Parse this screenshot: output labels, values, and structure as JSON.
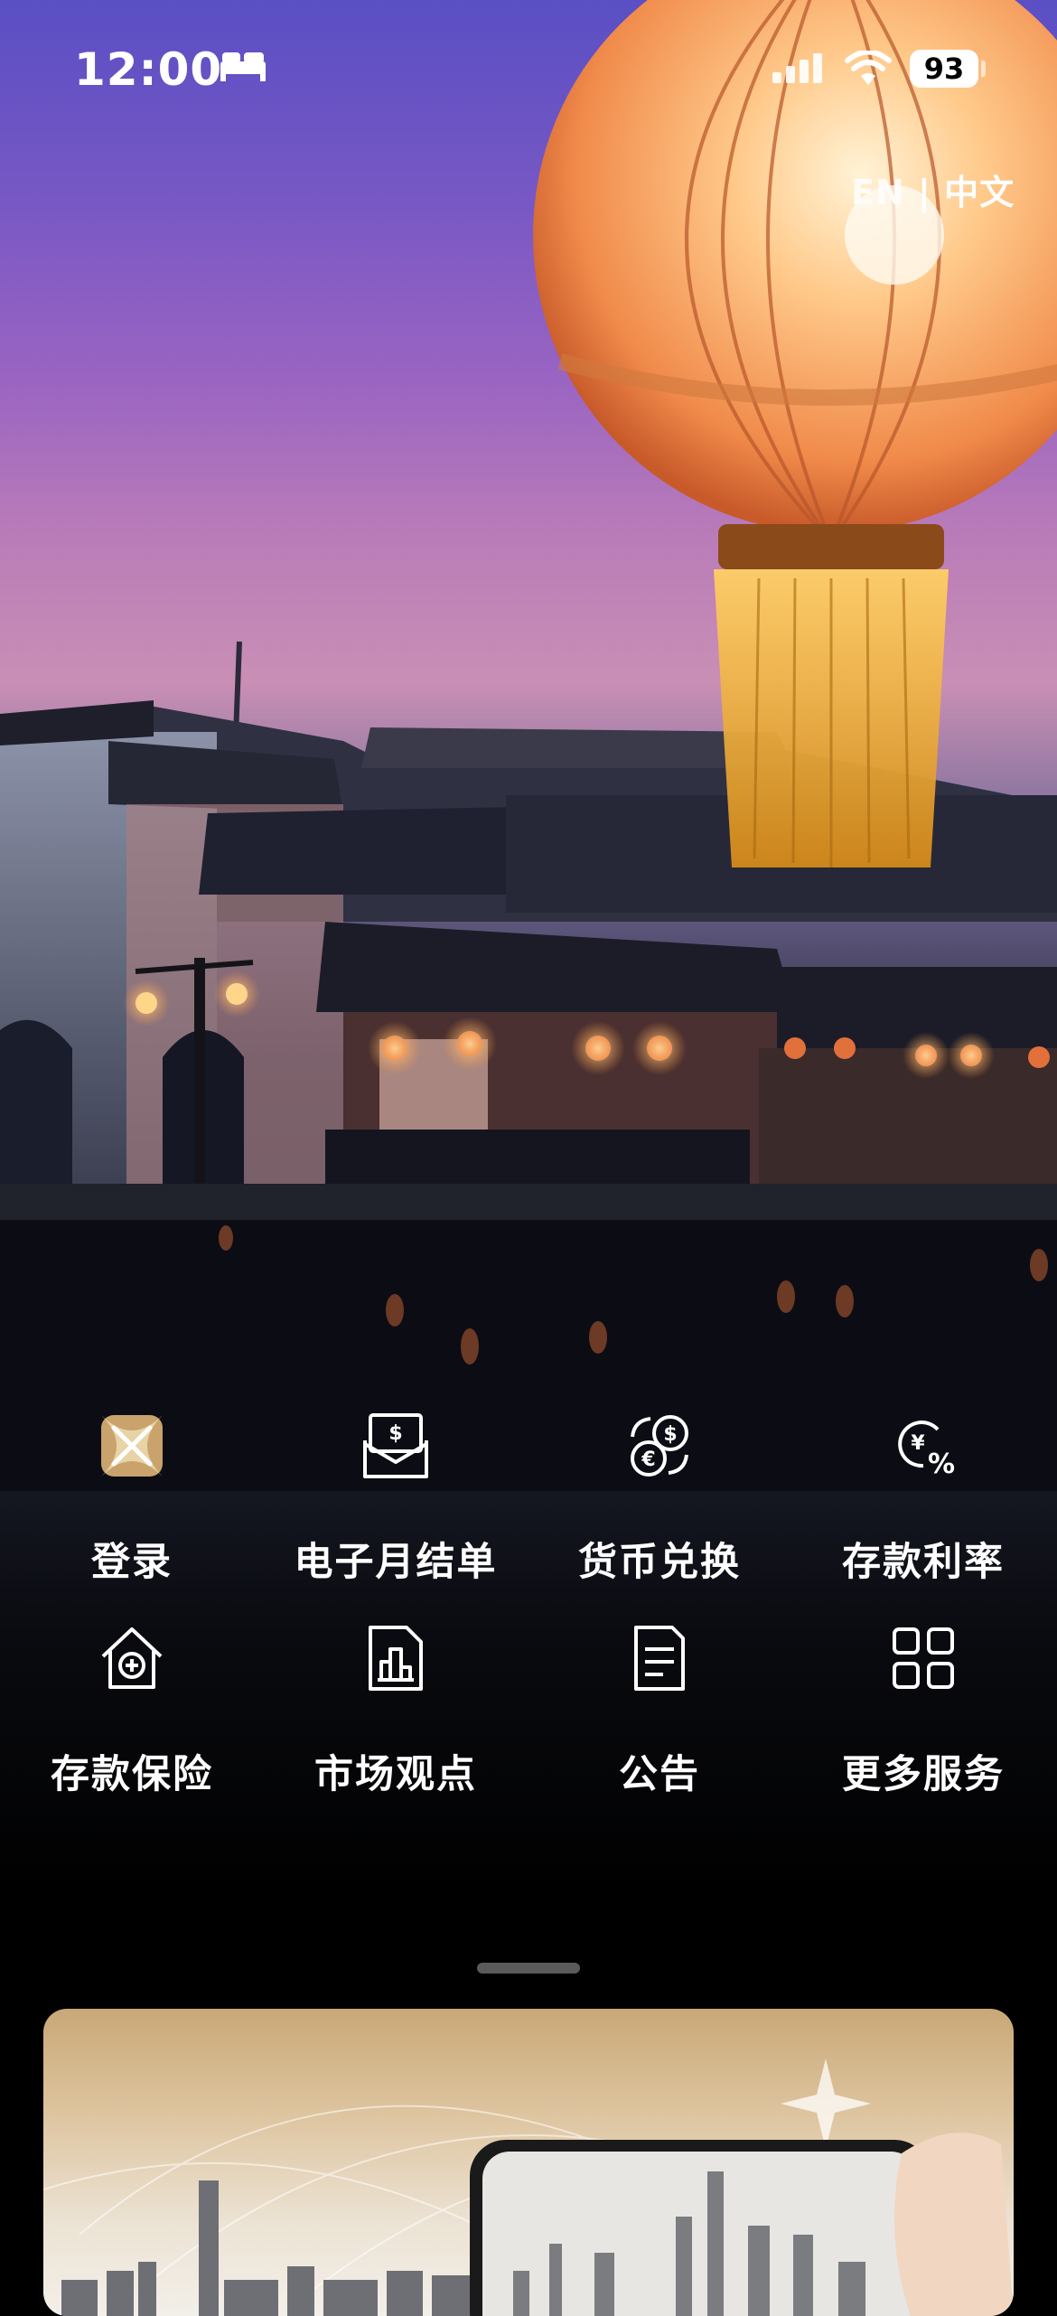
{
  "status_bar": {
    "time": "12:00",
    "battery": "93",
    "icons": [
      "bed-icon",
      "cellular-signal-icon",
      "wifi-icon",
      "battery-icon"
    ]
  },
  "language": {
    "en": "EN",
    "separator": "|",
    "zh": "中文"
  },
  "services": [
    {
      "label": "登录",
      "icon": "dbs-logo-icon"
    },
    {
      "label": "电子月结单",
      "icon": "e-statement-icon"
    },
    {
      "label": "货币兑换",
      "icon": "currency-exchange-icon"
    },
    {
      "label": "存款利率",
      "icon": "deposit-rate-icon"
    },
    {
      "label": "存款保险",
      "icon": "deposit-insurance-icon"
    },
    {
      "label": "市场观点",
      "icon": "market-insights-icon"
    },
    {
      "label": "公告",
      "icon": "announcement-icon"
    },
    {
      "label": "更多服务",
      "icon": "more-services-icon"
    }
  ],
  "colors": {
    "background": "#000000",
    "login_icon_gold": "#c9a36b",
    "text": "#ffffff"
  }
}
